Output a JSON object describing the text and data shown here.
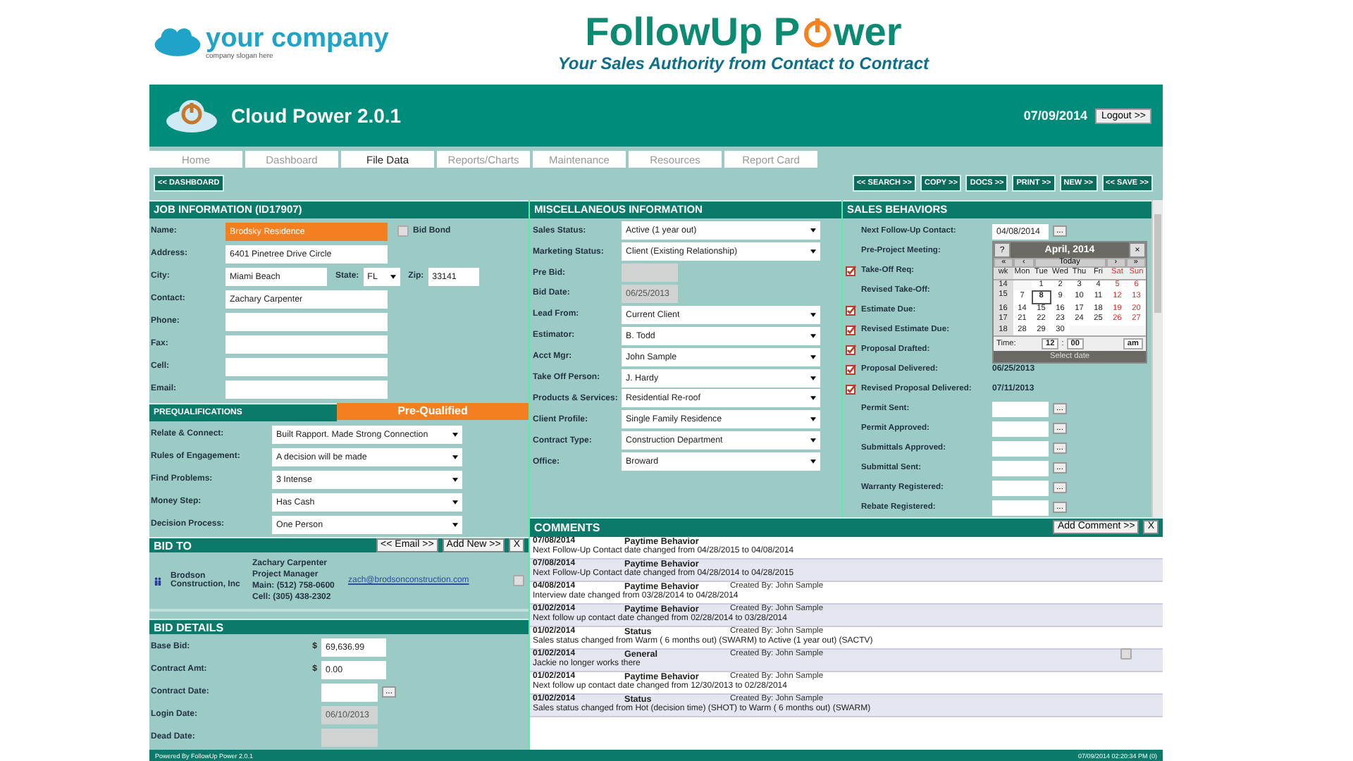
{
  "brand": {
    "company_name": "your company",
    "company_slogan": "company slogan here",
    "product_left": "FollowUp P",
    "product_right": "wer",
    "tagline": "Your Sales Authority from Contact to Contract"
  },
  "app": {
    "title": "Cloud Power 2.0.1",
    "date": "07/09/2014",
    "logout": "Logout >>"
  },
  "tabs": [
    {
      "label": "Home",
      "selected": false
    },
    {
      "label": "Dashboard",
      "selected": false
    },
    {
      "label": "File Data",
      "selected": true
    },
    {
      "label": "Reports/Charts",
      "selected": false
    },
    {
      "label": "Maintenance",
      "selected": false
    },
    {
      "label": "Resources",
      "selected": false
    },
    {
      "label": "Report Card",
      "selected": false
    }
  ],
  "toolbar": {
    "left": "<< DASHBOARD",
    "right": [
      "<< SEARCH >>",
      "COPY >>",
      "DOCS >>",
      "PRINT >>",
      "NEW >>",
      "<< SAVE >>"
    ]
  },
  "job": {
    "title": "JOB INFORMATION (ID17907)",
    "bid_bond": {
      "label": "Bid Bond",
      "checked": false
    },
    "rows": [
      {
        "kind": "name",
        "label": "Name:",
        "value": "Brodsky Residence"
      },
      {
        "kind": "text",
        "label": "Address:",
        "value": "6401 Pinetree Drive Circle"
      },
      {
        "kind": "city",
        "label": "City:",
        "value": "Miami Beach",
        "state_label": "State:",
        "state": "FL",
        "zip_label": "Zip:",
        "zip": "33141"
      },
      {
        "kind": "text",
        "label": "Contact:",
        "value": "Zachary Carpenter"
      },
      {
        "kind": "text",
        "label": "Phone:"
      },
      {
        "kind": "text",
        "label": "Fax:"
      },
      {
        "kind": "text",
        "label": "Cell:"
      },
      {
        "kind": "text",
        "label": "Email:"
      }
    ]
  },
  "prequal": {
    "title": "PREQUALIFICATIONS",
    "status": "Pre-Qualified",
    "rows": [
      {
        "label": "Relate & Connect:",
        "value": "Built Rapport. Made Strong Connection"
      },
      {
        "label": "Rules of Engagement:",
        "value": "A decision will be made"
      },
      {
        "label": "Find Problems:",
        "value": "3 Intense"
      },
      {
        "label": "Money Step:",
        "value": "Has Cash"
      },
      {
        "label": "Decision Process:",
        "value": "One Person"
      }
    ]
  },
  "bid_to": {
    "title": "BID TO",
    "buttons": [
      "<< Email >>",
      "Add New >>",
      "X"
    ],
    "company": "Brodson Construction, Inc",
    "contact_lines": [
      "Zachary Carpenter",
      "Project Manager",
      "Main:  (512) 758-0600",
      "Cell: (305) 438-2302"
    ],
    "email": "zach@brodsonconstruction.com",
    "checked": false
  },
  "bid_details": {
    "title": "BID DETAILS",
    "rows": [
      {
        "kind": "money",
        "label": "Base Bid:",
        "currency": "$",
        "value": "69,636.99"
      },
      {
        "kind": "money",
        "label": "Contract Amt:",
        "currency": "$",
        "value": "0.00"
      },
      {
        "kind": "date",
        "label": "Contract Date:",
        "button": "..."
      },
      {
        "kind": "readonly",
        "label": "Login Date:",
        "value": "06/10/2013"
      },
      {
        "kind": "readonly",
        "label": "Dead Date:"
      }
    ]
  },
  "misc": {
    "title": "MISCELLANEOUS INFORMATION",
    "rows": [
      {
        "kind": "select",
        "label": "Sales Status:",
        "value": "Active (1 year out)"
      },
      {
        "kind": "select",
        "label": "Marketing Status:",
        "value": "Client (Existing Relationship)"
      },
      {
        "kind": "readonly",
        "label": "Pre Bid:"
      },
      {
        "kind": "readonly",
        "label": "Bid Date:",
        "value": "06/25/2013"
      },
      {
        "kind": "select",
        "label": "Lead From:",
        "value": "Current Client"
      },
      {
        "kind": "select",
        "label": "Estimator:",
        "value": "B. Todd"
      },
      {
        "kind": "select",
        "label": "Acct Mgr:",
        "value": "John Sample"
      },
      {
        "kind": "select",
        "label": "Take Off Person:",
        "value": "J. Hardy"
      },
      {
        "kind": "select",
        "label": "Products & Services:",
        "value": "Residential Re-roof"
      },
      {
        "kind": "select",
        "label": "Client Profile:",
        "value": "Single Family Residence"
      },
      {
        "kind": "select",
        "label": "Contract Type:",
        "value": "Construction Department"
      },
      {
        "kind": "select",
        "label": "Office:",
        "value": "Broward"
      }
    ]
  },
  "sales": {
    "title": "SALES BEHAVIORS",
    "rows": [
      {
        "kind": "date",
        "label": "Next Follow-Up Contact:",
        "checked": false,
        "value": "04/08/2014",
        "button": "..."
      },
      {
        "kind": "covered",
        "label": "Pre-Project Meeting:",
        "checked": false
      },
      {
        "kind": "covered",
        "label": "Take-Off Req:",
        "checked": true
      },
      {
        "kind": "covered",
        "label": "Revised Take-Off:",
        "checked": false
      },
      {
        "kind": "covered",
        "label": "Estimate Due:",
        "checked": true
      },
      {
        "kind": "covered",
        "label": "Revised Estimate Due:",
        "checked": true
      },
      {
        "kind": "covered",
        "label": "Proposal Drafted:",
        "checked": true
      },
      {
        "kind": "value",
        "label": "Proposal Delivered:",
        "checked": true,
        "value": "06/25/2013"
      },
      {
        "kind": "value",
        "label": "Revised Proposal Delivered:",
        "checked": true,
        "value": "07/11/2013"
      },
      {
        "kind": "date",
        "label": "Permit Sent:",
        "checked": false,
        "button": "..."
      },
      {
        "kind": "date",
        "label": "Permit Approved:",
        "checked": false,
        "button": "..."
      },
      {
        "kind": "date",
        "label": "Submittals Approved:",
        "checked": false,
        "button": "..."
      },
      {
        "kind": "date",
        "label": "Submittal Sent:",
        "checked": false,
        "button": "..."
      },
      {
        "kind": "date",
        "label": "Warranty Registered:",
        "checked": false,
        "button": "..."
      },
      {
        "kind": "date",
        "label": "Rebate Registered:",
        "checked": false,
        "button": "..."
      }
    ]
  },
  "calendar": {
    "help": "?",
    "title": "April, 2014",
    "close": "×",
    "nav": [
      "«",
      "‹",
      "Today",
      "›",
      "»"
    ],
    "headers": [
      "wk",
      "Mon",
      "Tue",
      "Wed",
      "Thu",
      "Fri",
      "Sat",
      "Sun"
    ],
    "weeks": [
      {
        "wk": "14",
        "days": [
          {
            "kind": "blank"
          },
          {
            "d": "1",
            "selected": false
          },
          {
            "d": "2",
            "selected": false
          },
          {
            "d": "3",
            "selected": false
          },
          {
            "d": "4",
            "selected": false
          },
          {
            "d": "5",
            "selected": false
          },
          {
            "d": "6",
            "selected": false
          }
        ]
      },
      {
        "wk": "15",
        "days": [
          {
            "d": "7",
            "selected": false
          },
          {
            "d": "8",
            "selected": true
          },
          {
            "d": "9",
            "selected": false
          },
          {
            "d": "10",
            "selected": false
          },
          {
            "d": "11",
            "selected": false
          },
          {
            "d": "12",
            "selected": false
          },
          {
            "d": "13",
            "selected": false
          }
        ]
      },
      {
        "wk": "16",
        "days": [
          {
            "d": "14",
            "selected": false
          },
          {
            "d": "15",
            "selected": false
          },
          {
            "d": "16",
            "selected": false
          },
          {
            "d": "17",
            "selected": false
          },
          {
            "d": "18",
            "selected": false
          },
          {
            "d": "19",
            "selected": false
          },
          {
            "d": "20",
            "selected": false
          }
        ]
      },
      {
        "wk": "17",
        "days": [
          {
            "d": "21",
            "selected": false
          },
          {
            "d": "22",
            "selected": false
          },
          {
            "d": "23",
            "selected": false
          },
          {
            "d": "24",
            "selected": false
          },
          {
            "d": "25",
            "selected": false
          },
          {
            "d": "26",
            "selected": false
          },
          {
            "d": "27",
            "selected": false
          }
        ]
      },
      {
        "wk": "18",
        "days": [
          {
            "d": "28",
            "selected": false
          },
          {
            "d": "29",
            "selected": false
          },
          {
            "d": "30",
            "selected": false
          },
          {
            "kind": "blank"
          },
          {
            "kind": "blank"
          },
          {
            "kind": "blank"
          },
          {
            "kind": "blank"
          }
        ]
      }
    ],
    "time_label": "Time:",
    "hour": "12",
    "sep": ":",
    "minute": "00",
    "ampm": "am",
    "footer": "Select date"
  },
  "comments": {
    "title": "COMMENTS",
    "buttons": [
      "Add Comment >>",
      "X"
    ],
    "rows": [
      {
        "date": "07/08/2014",
        "type": "Paytime Behavior",
        "text": "Next Follow-Up Contact date changed from 04/28/2015 to 04/08/2014"
      },
      {
        "date": "07/08/2014",
        "type": "Paytime Behavior",
        "text": "Next Follow-Up Contact date changed from 04/28/2014 to 04/28/2015"
      },
      {
        "date": "04/08/2014",
        "type": "Paytime Behavior",
        "created_by": "Created By: John Sample",
        "text": "Interview date changed from 03/28/2014 to 04/28/2014"
      },
      {
        "date": "01/02/2014",
        "type": "Paytime Behavior",
        "created_by": "Created By: John Sample",
        "text": "Next follow up contact date changed from 02/28/2014 to 03/28/2014"
      },
      {
        "date": "01/02/2014",
        "type": "Status",
        "created_by": "Created By: John Sample",
        "text": "Sales status changed from Warm ( 6 months out) (SWARM) to Active (1 year out) (SACTV)"
      },
      {
        "date": "01/02/2014",
        "type": "General",
        "created_by": "Created By: John Sample",
        "text": "Jackie no longer works there",
        "checked": false
      },
      {
        "date": "01/02/2014",
        "type": "Paytime Behavior",
        "created_by": "Created By: John Sample",
        "text": "Next follow up contact date changed from 12/30/2013 to 02/28/2014"
      },
      {
        "date": "01/02/2014",
        "type": "Status",
        "created_by": "Created By: John Sample",
        "text": "Sales status changed from Hot (decision time) (SHOT) to Warm ( 6 months out) (SWARM)"
      }
    ]
  },
  "footer": {
    "left": "Powered By FollowUp Power 2.0.1",
    "right": "07/09/2014 02:20:34 PM (0)"
  }
}
